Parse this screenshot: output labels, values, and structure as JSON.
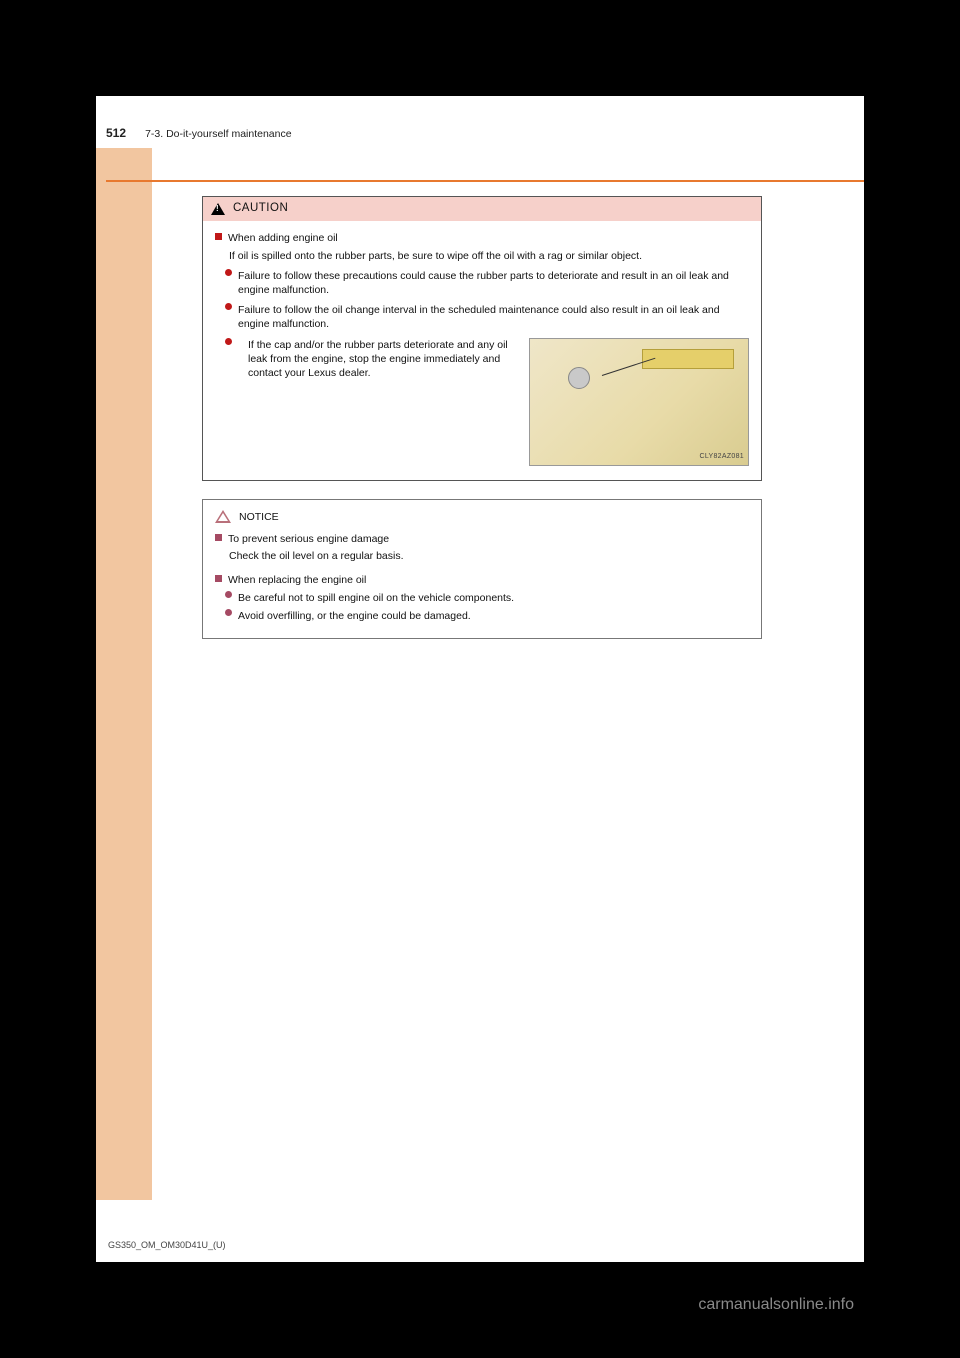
{
  "header": {
    "page_number": "512",
    "section": "7-3. Do-it-yourself maintenance"
  },
  "caution": {
    "label": "CAUTION",
    "heading": "When adding engine oil",
    "intro": "If oil is spilled onto the rubber parts, be sure to wipe off the oil with a rag or similar object.",
    "bullets": [
      "Failure to follow these precautions could cause the rubber parts to deteriorate and result in an oil leak and engine malfunction.",
      "Failure to follow the oil change interval in the scheduled maintenance could also result in an oil leak and engine malfunction.",
      "If the cap and/or the rubber parts deteriorate and any oil leak from the engine, stop the engine immediately and contact your Lexus dealer."
    ],
    "image_ref": "CLY82AZ081"
  },
  "notice": {
    "label": "NOTICE",
    "sections": [
      {
        "heading": "To prevent serious engine damage",
        "text": "Check the oil level on a regular basis."
      },
      {
        "heading": "When replacing the engine oil",
        "bullets": [
          "Be careful not to spill engine oil on the vehicle components.",
          "Avoid overfilling, or the engine could be damaged."
        ]
      }
    ]
  },
  "footer": "GS350_OM_OM30D41U_(U)",
  "watermark": "carmanualsonline.info"
}
